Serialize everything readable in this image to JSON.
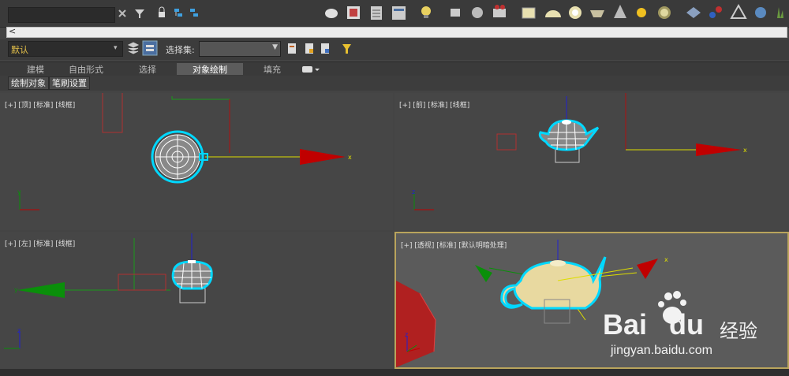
{
  "toolbar": {
    "search_value": "",
    "icons": [
      "close-icon",
      "filter-icon",
      "lock-icon",
      "link-icon",
      "unlink-icon",
      "teapot-icon",
      "render-frame-icon",
      "render-setup-icon",
      "rendered-frame-window-icon",
      "light-icon",
      "camera-icon",
      "spotlight-icon",
      "video-icon",
      "plane-icon",
      "dome-icon",
      "sphere-icon",
      "bowl-icon",
      "cone-icon",
      "sun-icon",
      "disk-icon",
      "grid-icon",
      "molecule-icon",
      "triangle-icon",
      "gear-icon",
      "grass-icon"
    ]
  },
  "command_bar": {
    "arrow": "<"
  },
  "layer": {
    "value": "默认",
    "dropdown": "▾"
  },
  "selection_set": {
    "label": "选择集:",
    "value": ""
  },
  "ribbon": {
    "tabs": [
      "建模",
      "自由形式",
      "选择",
      "对象绘制",
      "填充"
    ],
    "active": "对象绘制"
  },
  "subtabs": [
    "绘制对象",
    "笔刷设置"
  ],
  "viewports": {
    "top": {
      "label": "[+] [顶] [标准] [线框]"
    },
    "front": {
      "label": "[+] [前] [标准] [线框]"
    },
    "left": {
      "label": "[+] [左] [标准] [线框]"
    },
    "persp": {
      "label": "[+] [透视] [标准] [默认明暗处理]"
    }
  },
  "axis": {
    "x": "x",
    "y": "y",
    "z": "z"
  },
  "watermark": {
    "brand": "Bai",
    "brand2": "du",
    "cn": "经验",
    "url": "jingyan.baidu.com"
  },
  "colors": {
    "selection": "#00d8ff",
    "x_axis": "#c00000",
    "y_axis": "#0a8f0a",
    "z_axis": "#2020d0",
    "gizmo_line": "#e0e000",
    "teapot": "#e8d9a0"
  }
}
